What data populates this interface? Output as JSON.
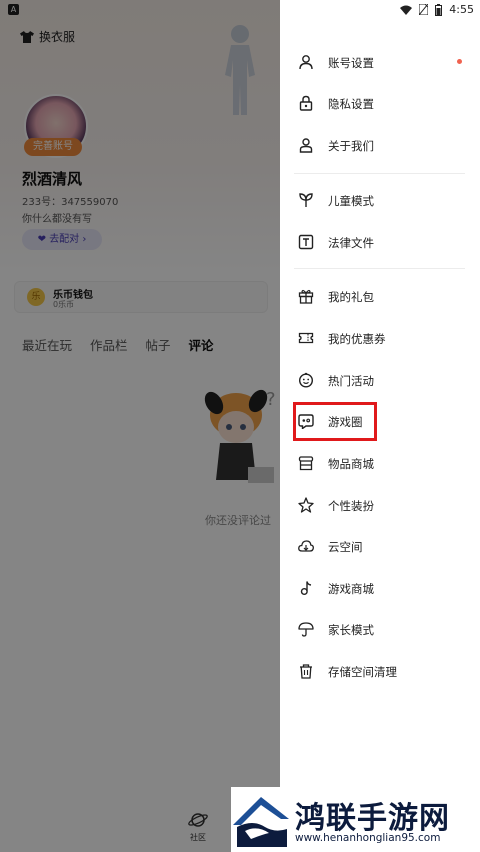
{
  "status_bar": {
    "left_badge": "A",
    "time": "4:55"
  },
  "profile": {
    "outfit_label": "换衣服",
    "complete_badge": "完善账号",
    "username": "烈酒清风",
    "uid": "233号：347559070",
    "bio": "你什么都没有写",
    "match_button": "去配对",
    "wallet": {
      "coin": "乐",
      "name": "乐币钱包",
      "balance": "0乐币"
    },
    "tabs": [
      "最近在玩",
      "作品栏",
      "帖子",
      "评论"
    ],
    "active_tab": "评论",
    "empty_text": "你还没评论过",
    "bottom_nav_label": "社区"
  },
  "drawer": {
    "groups": [
      [
        {
          "label": "账号设置",
          "icon": "user-icon",
          "badge_dot": true
        },
        {
          "label": "隐私设置",
          "icon": "lock-icon"
        },
        {
          "label": "关于我们",
          "icon": "info-person-icon"
        }
      ],
      [
        {
          "label": "儿童模式",
          "icon": "sprout-icon"
        },
        {
          "label": "法律文件",
          "icon": "document-t-icon"
        }
      ],
      [
        {
          "label": "我的礼包",
          "icon": "gift-icon"
        },
        {
          "label": "我的优惠券",
          "icon": "coupon-icon"
        },
        {
          "label": "热门活动",
          "icon": "smile-face-icon"
        },
        {
          "label": "游戏圈",
          "icon": "game-circle-icon",
          "highlighted": true
        },
        {
          "label": "物品商城",
          "icon": "store-icon"
        },
        {
          "label": "个性装扮",
          "icon": "sparkle-icon"
        },
        {
          "label": "云空间",
          "icon": "cloud-icon"
        },
        {
          "label": "游戏商城",
          "icon": "music-note-icon"
        },
        {
          "label": "家长模式",
          "icon": "umbrella-icon"
        },
        {
          "label": "存储空间清理",
          "icon": "trash-icon"
        }
      ]
    ],
    "highlight_color": "#e0191b",
    "badge_color": "#f0624f"
  },
  "watermark": {
    "title": "鸿联手游网",
    "url": "www.henanhonglian95.com"
  }
}
